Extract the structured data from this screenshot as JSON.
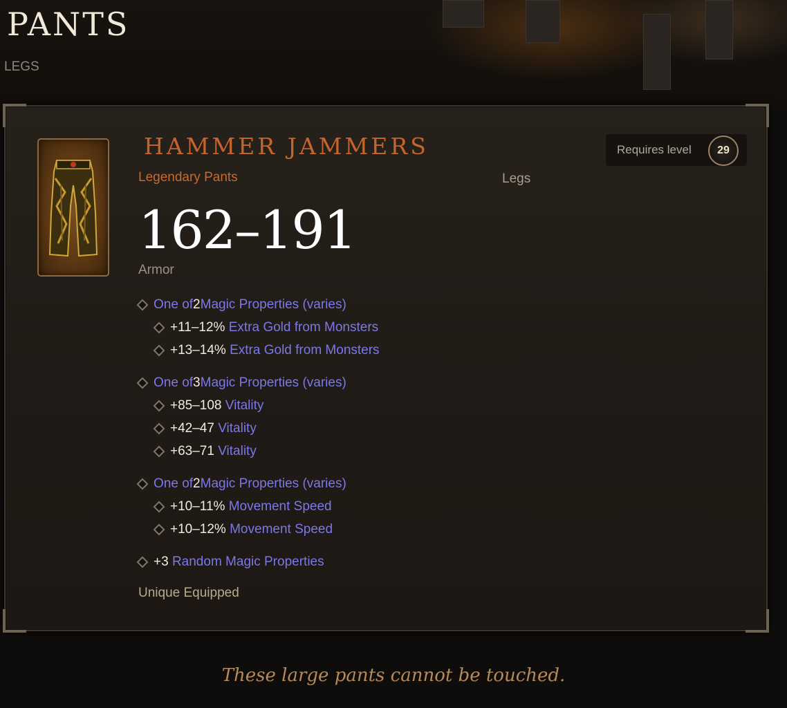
{
  "page": {
    "title": "PANTS",
    "subtitle": "LEGS"
  },
  "item": {
    "icon": "legendary-pants-icon",
    "name": "HAMMER JAMMERS",
    "type": "Legendary Pants",
    "slot": "Legs",
    "requires_label": "Requires level",
    "requires_level": "29",
    "armor_value": "162–191",
    "armor_label": "Armor",
    "property_groups": [
      {
        "head": {
          "prefix": "One of ",
          "count": "2",
          "text": " Magic Properties (varies)"
        },
        "options": [
          {
            "value": "+11–12%",
            "stat": "Extra Gold from Monsters"
          },
          {
            "value": "+13–14%",
            "stat": "Extra Gold from Monsters"
          }
        ]
      },
      {
        "head": {
          "prefix": "One of ",
          "count": "3",
          "text": " Magic Properties (varies)"
        },
        "options": [
          {
            "value": "+85–108",
            "stat": "Vitality"
          },
          {
            "value": "+42–47",
            "stat": "Vitality"
          },
          {
            "value": "+63–71",
            "stat": "Vitality"
          }
        ]
      },
      {
        "head": {
          "prefix": "One of ",
          "count": "2",
          "text": " Magic Properties (varies)"
        },
        "options": [
          {
            "value": "+10–11%",
            "stat": "Movement Speed"
          },
          {
            "value": "+10–12%",
            "stat": "Movement Speed"
          }
        ]
      }
    ],
    "random_props": {
      "value": "+3",
      "text": "Random Magic Properties"
    },
    "unique_label": "Unique Equipped",
    "flavor_text": "These large pants cannot be touched."
  },
  "colors": {
    "legendary": "#c4652d",
    "magic": "#7d78e8",
    "flavor": "#b6895a"
  }
}
